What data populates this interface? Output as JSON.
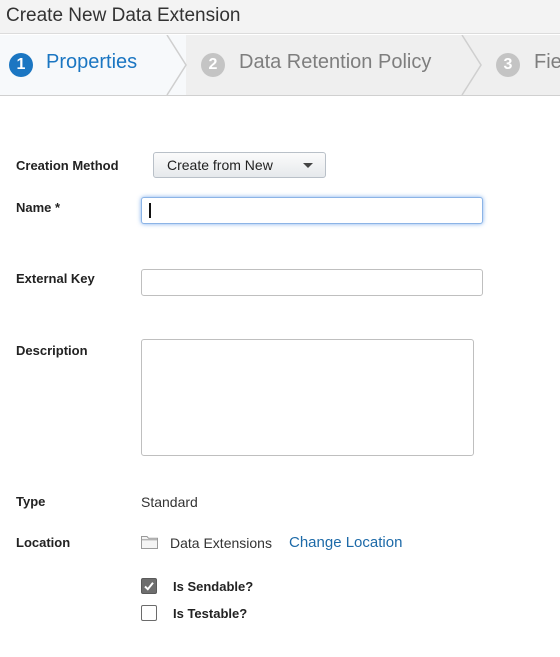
{
  "header": {
    "title": "Create New Data Extension"
  },
  "wizard": {
    "steps": [
      {
        "number": "1",
        "label": "Properties",
        "state": "active"
      },
      {
        "number": "2",
        "label": "Data Retention Policy",
        "state": "inactive"
      },
      {
        "number": "3",
        "label": "Fie",
        "state": "inactive"
      }
    ],
    "active_color": "#1b76c2"
  },
  "form": {
    "creation_method": {
      "label": "Creation Method",
      "value": "Create from New"
    },
    "name": {
      "label": "Name *",
      "value": ""
    },
    "external_key": {
      "label": "External Key",
      "value": ""
    },
    "description": {
      "label": "Description",
      "value": ""
    },
    "type": {
      "label": "Type",
      "value": "Standard"
    },
    "location": {
      "label": "Location",
      "folder": "Data Extensions",
      "change_link": "Change Location",
      "icon": "folder-icon"
    },
    "is_sendable": {
      "label": "Is Sendable?",
      "checked": true
    },
    "is_testable": {
      "label": "Is Testable?",
      "checked": false
    }
  }
}
